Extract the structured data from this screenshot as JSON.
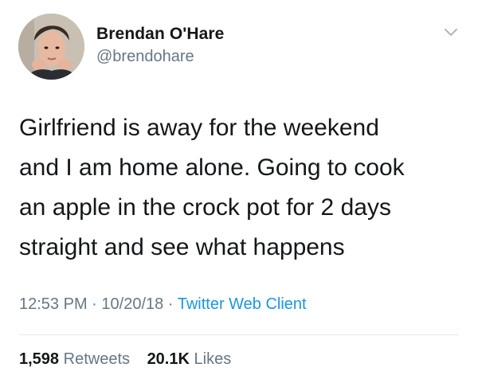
{
  "author": {
    "display_name": "Brendan O'Hare",
    "handle": "@brendohare"
  },
  "tweet": {
    "lines": [
      "Girlfriend is away for the weekend",
      "and I am home alone. Going to cook",
      "an apple in the crock pot for 2 days",
      "straight and see what happens"
    ]
  },
  "meta": {
    "time": "12:53 PM",
    "separator": "·",
    "date": "10/20/18",
    "source": "Twitter Web Client"
  },
  "stats": {
    "retweets_count": "1,598",
    "retweets_label": "Retweets",
    "likes_count": "20.1K",
    "likes_label": "Likes"
  },
  "icons": {
    "menu": "chevron-down-icon"
  },
  "colors": {
    "text": "#14171a",
    "secondary": "#657786",
    "link": "#1b95e0",
    "divider": "#e1e8ed"
  }
}
